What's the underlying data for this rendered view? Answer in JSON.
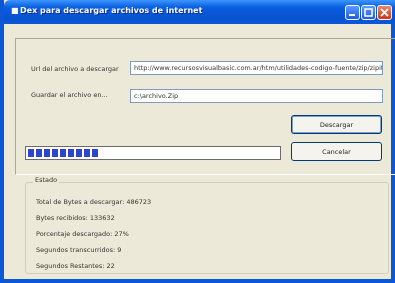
{
  "window": {
    "title": "Dex para descargar archivos de internet"
  },
  "form": {
    "url_label": "Url del archivo a descargar",
    "url_value": "http://www.recursosvisualbasic.com.ar/htm/utilidades-codigo-fuente/zip/zipit",
    "save_label": "Guardar el archivo en...",
    "save_value": "c:\\archivo.Zip",
    "download_button": "Descargar",
    "cancel_button": "Cancelar"
  },
  "progress": {
    "percent": 27,
    "blocks": 9
  },
  "status": {
    "group_title": "Estado",
    "total_bytes": "Total de Bytes a descargar: 486723",
    "received_bytes": "Bytes recibidos: 133632",
    "percent": "Porcentaje descargado: 27%",
    "elapsed": "Segundos transcurridos: 9",
    "remaining": "Segundos Restantes: 22"
  },
  "colors": {
    "titlebar": "#0a58d8",
    "progress_fill": "#2d46c8",
    "window_bg": "#ece9d8"
  }
}
